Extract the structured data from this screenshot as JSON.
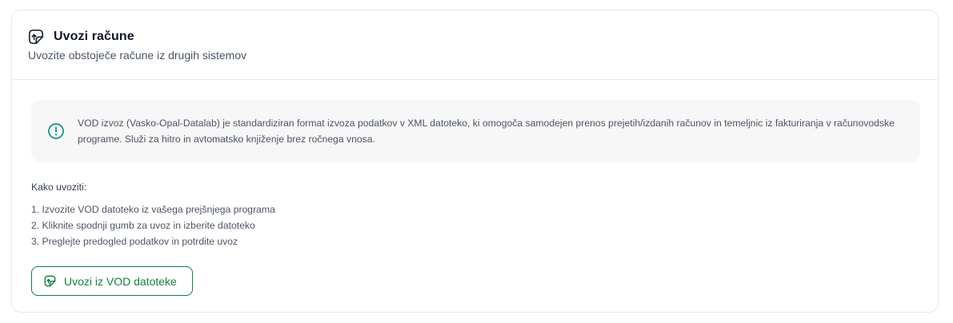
{
  "header": {
    "title": "Uvozi račune",
    "subtitle": "Uvozite obstoječe račune iz drugih sistemov",
    "icon": "file-import-icon"
  },
  "info": {
    "icon": "alert-circle-icon",
    "text": "VOD izvoz (Vasko-Opal-Datalab) je standardiziran format izvoza podatkov v XML datoteko, ki omogoča samodejen prenos prejetih/izdanih računov in temeljnic iz fakturiranja v računovodske programe. Služi za hitro in avtomatsko knjiženje brez ročnega vnosa."
  },
  "steps": {
    "title": "Kako uvoziti:",
    "items": [
      "1. Izvozite VOD datoteko iz vašega prejšnjega programa",
      "2. Kliknite spodnji gumb za uvoz in izberite datoteko",
      "3. Preglejte predogled podatkov in potrdite uvoz"
    ]
  },
  "button": {
    "label": "Uvozi iz VOD datoteke",
    "icon": "file-import-icon"
  },
  "colors": {
    "accent": "#15803d",
    "info_icon": "#0d9488",
    "info_bg": "#f7f7f7",
    "border": "#e5e7eb"
  }
}
